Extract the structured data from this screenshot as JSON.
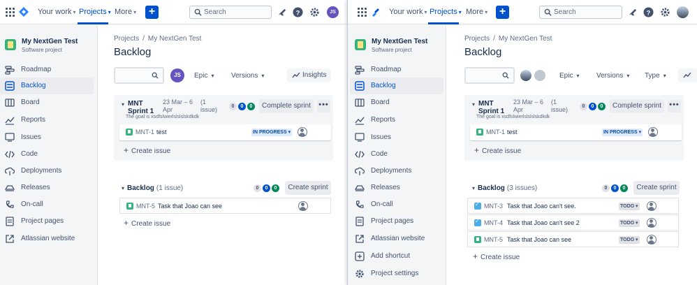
{
  "left": {
    "nav": {
      "your_work": "Your work",
      "projects": "Projects",
      "more": "More",
      "search_placeholder": "Search",
      "avatar_initials": "JS"
    },
    "sidebar": {
      "project_name": "My NextGen Test",
      "project_type": "Software project",
      "items": [
        {
          "label": "Roadmap",
          "icon": "roadmap-icon"
        },
        {
          "label": "Backlog",
          "icon": "backlog-icon",
          "active": true
        },
        {
          "label": "Board",
          "icon": "board-icon"
        },
        {
          "label": "Reports",
          "icon": "reports-icon"
        },
        {
          "label": "Issues",
          "icon": "issues-icon"
        },
        {
          "label": "Code",
          "icon": "code-icon"
        },
        {
          "label": "Deployments",
          "icon": "deployments-icon"
        },
        {
          "label": "Releases",
          "icon": "releases-icon"
        },
        {
          "label": "On-call",
          "icon": "on-call-icon"
        },
        {
          "label": "Project pages",
          "icon": "project-pages-icon"
        },
        {
          "label": "Atlassian website",
          "icon": "external-link-icon"
        }
      ]
    },
    "breadcrumb": {
      "root": "Projects",
      "separator": "/",
      "project": "My NextGen Test"
    },
    "page_title": "Backlog",
    "filters": {
      "avatar_initials": "JS",
      "epic": "Epic",
      "versions": "Versions",
      "insights": "Insights"
    },
    "sprint": {
      "name_line1": "MNT",
      "name_line2": "Sprint 1",
      "date_line1": "23 Mar – 6",
      "date_line2": "Apr",
      "count_line1": "(1",
      "count_line2": "issue)",
      "goal": "The goal is xsdfslwierlslslslskdkdk",
      "pills": [
        "0",
        "0",
        "0"
      ],
      "complete_button": "Complete sprint",
      "more_button": "•••",
      "issues": [
        {
          "key": "MNT-1",
          "summary": "test",
          "status": "IN PROGRESS ▾",
          "type": "story"
        }
      ],
      "create_issue": "Create issue"
    },
    "backlog": {
      "title": "Backlog",
      "count": "(1 issue)",
      "pills": [
        "0",
        "0",
        "0"
      ],
      "create_sprint": "Create sprint",
      "issues": [
        {
          "key": "MNT-5",
          "summary": "Task that Joao can see",
          "type": "story"
        }
      ],
      "create_issue": "Create issue"
    }
  },
  "right": {
    "nav": {
      "your_work": "Your work",
      "projects": "Projects",
      "more": "More",
      "search_placeholder": "Search"
    },
    "sidebar": {
      "project_name": "My NextGen Test",
      "project_type": "Software project",
      "items": [
        {
          "label": "Roadmap",
          "icon": "roadmap-icon"
        },
        {
          "label": "Backlog",
          "icon": "backlog-icon",
          "active": true
        },
        {
          "label": "Board",
          "icon": "board-icon"
        },
        {
          "label": "Reports",
          "icon": "reports-icon"
        },
        {
          "label": "Issues",
          "icon": "issues-icon"
        },
        {
          "label": "Code",
          "icon": "code-icon"
        },
        {
          "label": "Deployments",
          "icon": "deployments-icon"
        },
        {
          "label": "Releases",
          "icon": "releases-icon"
        },
        {
          "label": "On-call",
          "icon": "on-call-icon"
        },
        {
          "label": "Project pages",
          "icon": "project-pages-icon"
        },
        {
          "label": "Atlassian website",
          "icon": "external-link-icon"
        },
        {
          "label": "Add shortcut",
          "icon": "add-shortcut-icon"
        },
        {
          "label": "Project settings",
          "icon": "gear-icon"
        }
      ]
    },
    "breadcrumb": {
      "root": "Projects",
      "separator": "/",
      "project": "My NextGen Test"
    },
    "page_title": "Backlog",
    "filters": {
      "epic": "Epic",
      "versions": "Versions",
      "type": "Type"
    },
    "sprint": {
      "name_line1": "MNT",
      "name_line2": "Sprint 1",
      "date_line1": "23 Mar – 6",
      "date_line2": "Apr",
      "count_line1": "(1",
      "count_line2": "issue)",
      "goal": "The goal is xsdfslwierlslslslskdkdk",
      "pills": [
        "0",
        "0",
        "0"
      ],
      "complete_button": "Complete sprint",
      "more_button": "•••",
      "issues": [
        {
          "key": "MNT-1",
          "summary": "test",
          "status": "IN PROGRESS ▾",
          "type": "story"
        }
      ],
      "create_issue": "Create issue"
    },
    "backlog": {
      "title": "Backlog",
      "count": "(3 issues)",
      "pills": [
        "0",
        "0",
        "0"
      ],
      "create_sprint": "Create sprint",
      "issues": [
        {
          "key": "MNT-3",
          "summary": "Task that Joao can't see.",
          "status": "TODO ▾",
          "type": "task"
        },
        {
          "key": "MNT-4",
          "summary": "Task that Joao can't see 2",
          "status": "TODO ▾",
          "type": "task"
        },
        {
          "key": "MNT-5",
          "summary": "Task that Joao can see",
          "status": "TODO ▾",
          "type": "story"
        }
      ],
      "create_issue": "Create issue"
    }
  },
  "colors": {
    "brand_blue": "#0052cc",
    "sidebar_bg": "#f4f5f7",
    "done_green": "#00875a",
    "text": "#172b4d"
  }
}
